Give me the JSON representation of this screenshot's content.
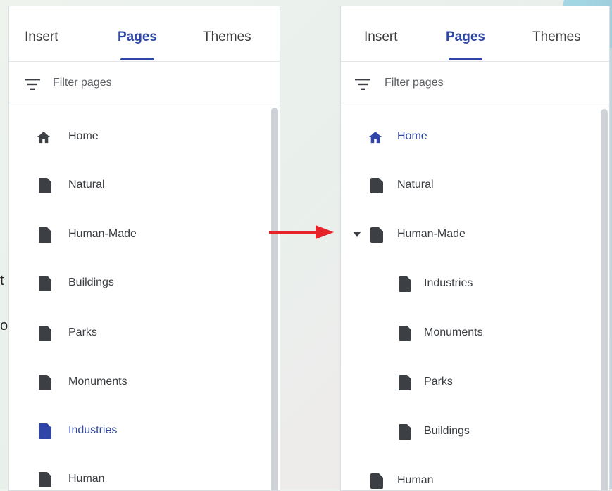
{
  "left_panel": {
    "tabs": [
      {
        "label": "Insert",
        "active": false
      },
      {
        "label": "Pages",
        "active": true
      },
      {
        "label": "Themes",
        "active": false
      }
    ],
    "filter_placeholder": "Filter pages",
    "items": [
      {
        "label": "Home",
        "icon": "home-icon",
        "active": false
      },
      {
        "label": "Natural",
        "icon": "page-icon",
        "active": false
      },
      {
        "label": "Human-Made",
        "icon": "page-icon",
        "active": false
      },
      {
        "label": "Buildings",
        "icon": "page-icon",
        "active": false
      },
      {
        "label": "Parks",
        "icon": "page-icon",
        "active": false
      },
      {
        "label": "Monuments",
        "icon": "page-icon",
        "active": false
      },
      {
        "label": "Industries",
        "icon": "page-icon",
        "active": true
      },
      {
        "label": "Human",
        "icon": "page-icon",
        "active": false
      }
    ]
  },
  "right_panel": {
    "tabs": [
      {
        "label": "Insert",
        "active": false
      },
      {
        "label": "Pages",
        "active": true
      },
      {
        "label": "Themes",
        "active": false
      }
    ],
    "filter_placeholder": "Filter pages",
    "items": [
      {
        "label": "Home",
        "icon": "home-icon",
        "active": true
      },
      {
        "label": "Natural",
        "icon": "page-icon",
        "active": false
      },
      {
        "label": "Human-Made",
        "icon": "page-icon",
        "active": false,
        "expanded": true
      },
      {
        "label": "Industries",
        "icon": "page-icon",
        "active": false,
        "child": true
      },
      {
        "label": "Monuments",
        "icon": "page-icon",
        "active": false,
        "child": true
      },
      {
        "label": "Parks",
        "icon": "page-icon",
        "active": false,
        "child": true
      },
      {
        "label": "Buildings",
        "icon": "page-icon",
        "active": false,
        "child": true
      },
      {
        "label": "Human",
        "icon": "page-icon",
        "active": false
      }
    ]
  },
  "stray_text": [
    "t",
    "o"
  ],
  "colors": {
    "accent": "#2f46a8",
    "text": "#3a3d41",
    "icon": "#3c3f43",
    "arrow": "#e52329"
  }
}
